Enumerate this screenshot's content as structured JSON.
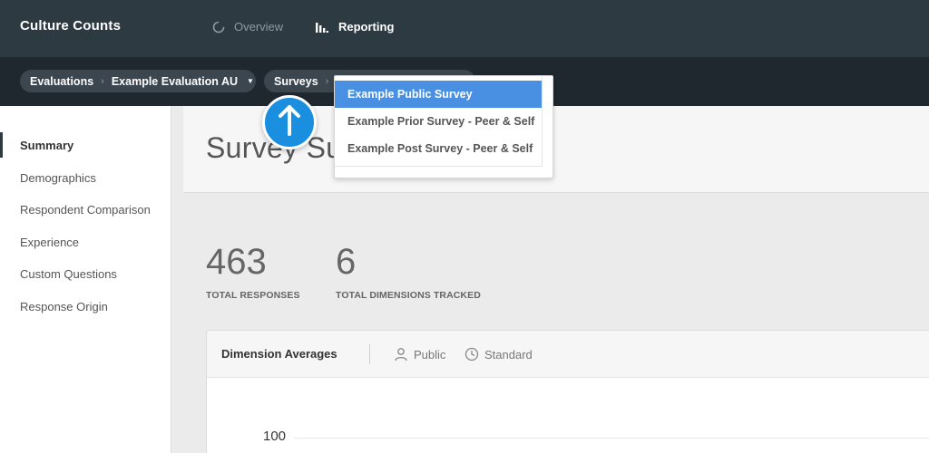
{
  "app": {
    "title": "Culture Counts"
  },
  "topnav": {
    "overview": {
      "label": "Overview",
      "icon": "loading-circle-icon"
    },
    "reporting": {
      "label": "Reporting",
      "icon": "bar-chart-icon"
    }
  },
  "breadcrumbs": {
    "evaluations": "Evaluations",
    "evaluation": "Example Evaluation AU",
    "surveys": "Surveys"
  },
  "dropdown": {
    "options": [
      {
        "label": "Example Public Survey",
        "selected": true
      },
      {
        "label": "Example Prior Survey - Peer & Self",
        "selected": false
      },
      {
        "label": "Example Post Survey - Peer & Self",
        "selected": false
      }
    ]
  },
  "sidebar": {
    "items": [
      {
        "label": "Summary",
        "active": true
      },
      {
        "label": "Demographics",
        "active": false
      },
      {
        "label": "Respondent Comparison",
        "active": false
      },
      {
        "label": "Experience",
        "active": false
      },
      {
        "label": "Custom Questions",
        "active": false
      },
      {
        "label": "Response Origin",
        "active": false
      }
    ]
  },
  "page": {
    "title": "Survey Sur"
  },
  "stats": [
    {
      "value": "463",
      "label": "TOTAL RESPONSES"
    },
    {
      "value": "6",
      "label": "TOTAL DIMENSIONS TRACKED"
    }
  ],
  "card": {
    "title": "Dimension Averages",
    "tags": [
      {
        "label": "Public",
        "icon": "person-icon"
      },
      {
        "label": "Standard",
        "icon": "clock-icon"
      }
    ],
    "y_tick": "100"
  },
  "colors": {
    "topbar": "#2e3a42",
    "crumbbar": "#1f282e",
    "selected": "#4a90e2",
    "pointer": "#1a8fe0"
  }
}
